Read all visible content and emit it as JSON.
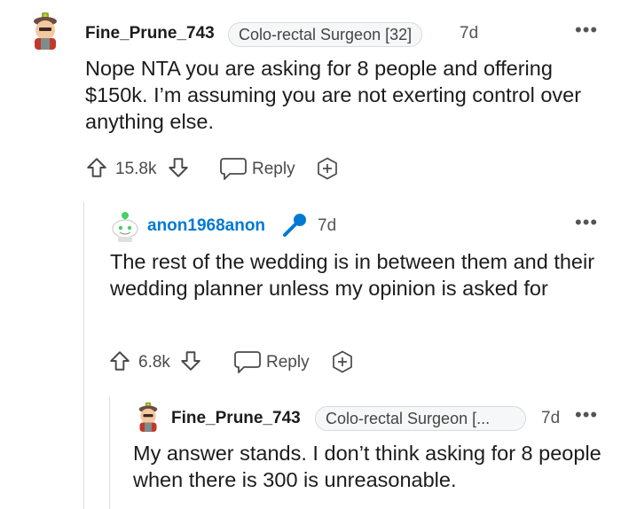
{
  "comments": [
    {
      "username": "Fine_Prune_743",
      "flair": "Colo-rectal Surgeon [32]",
      "time": "7d",
      "body": "Nope NTA you are asking for 8 people and offering $150k. I’m assuming you are not exerting control over anything else.",
      "votes": "15.8k",
      "reply_label": "Reply",
      "avatar_icon": "avatar-icon",
      "colors": {
        "username": "#1c1c1c"
      }
    },
    {
      "username": "anon1968anon",
      "time": "7d",
      "body": "The rest of the wedding is in between them and their wedding planner unless my opinion is asked for",
      "votes": "6.8k",
      "reply_label": "Reply",
      "badge_icon": "microphone-icon",
      "avatar_icon": "avatar-icon",
      "colors": {
        "username": "#0079d3"
      }
    },
    {
      "username": "Fine_Prune_743",
      "flair": "Colo-rectal Surgeon [...",
      "time": "7d",
      "body": "My answer stands. I don’t think asking for 8 people when there is 300 is unreasonable.",
      "avatar_icon": "avatar-icon",
      "colors": {
        "username": "#1c1c1c"
      }
    }
  ],
  "more_options": "•••"
}
